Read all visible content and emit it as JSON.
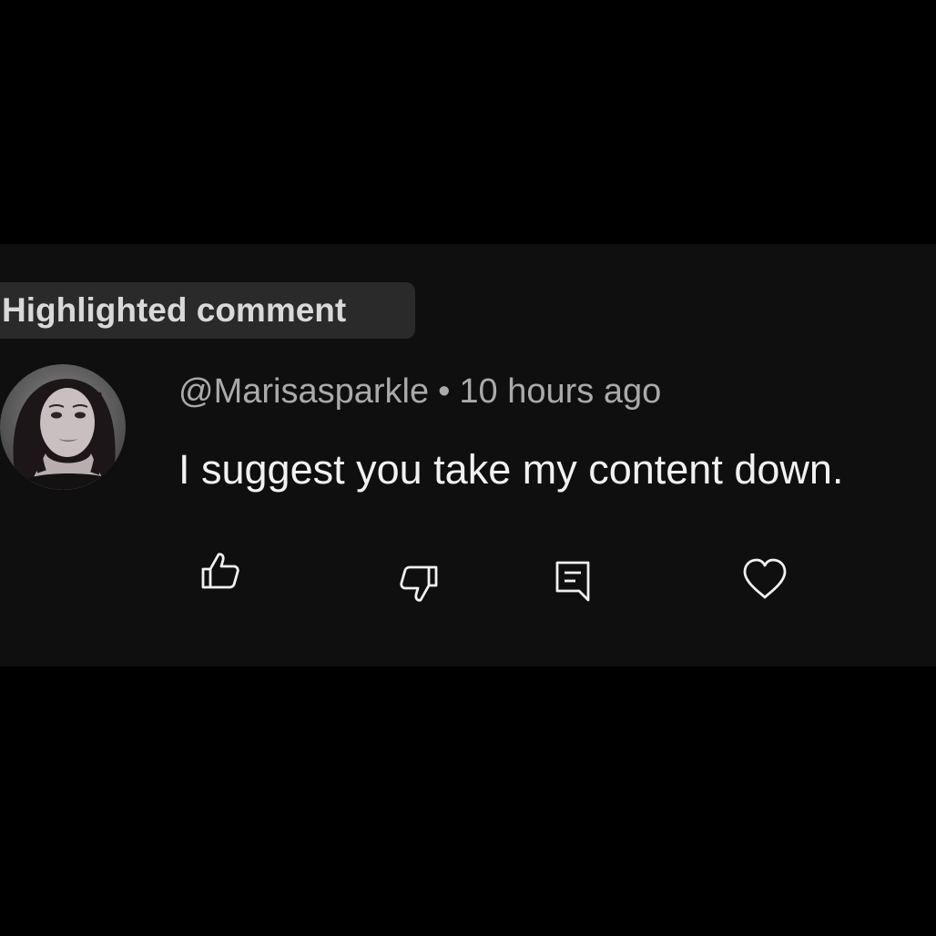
{
  "comment": {
    "badge_label": "Highlighted comment",
    "author": "@Marisasparkle",
    "separator": "•",
    "timestamp": "10 hours ago",
    "text": "I suggest you take my content down."
  },
  "actions": {
    "like_icon": "thumbs-up-icon",
    "dislike_icon": "thumbs-down-icon",
    "reply_icon": "reply-comment-icon",
    "heart_icon": "heart-icon"
  },
  "colors": {
    "page_background": "#000000",
    "card_background": "#0f0f0f",
    "badge_background": "#2a2a2a",
    "meta_text": "#aaaaaa",
    "comment_text": "#f1f1f1"
  }
}
